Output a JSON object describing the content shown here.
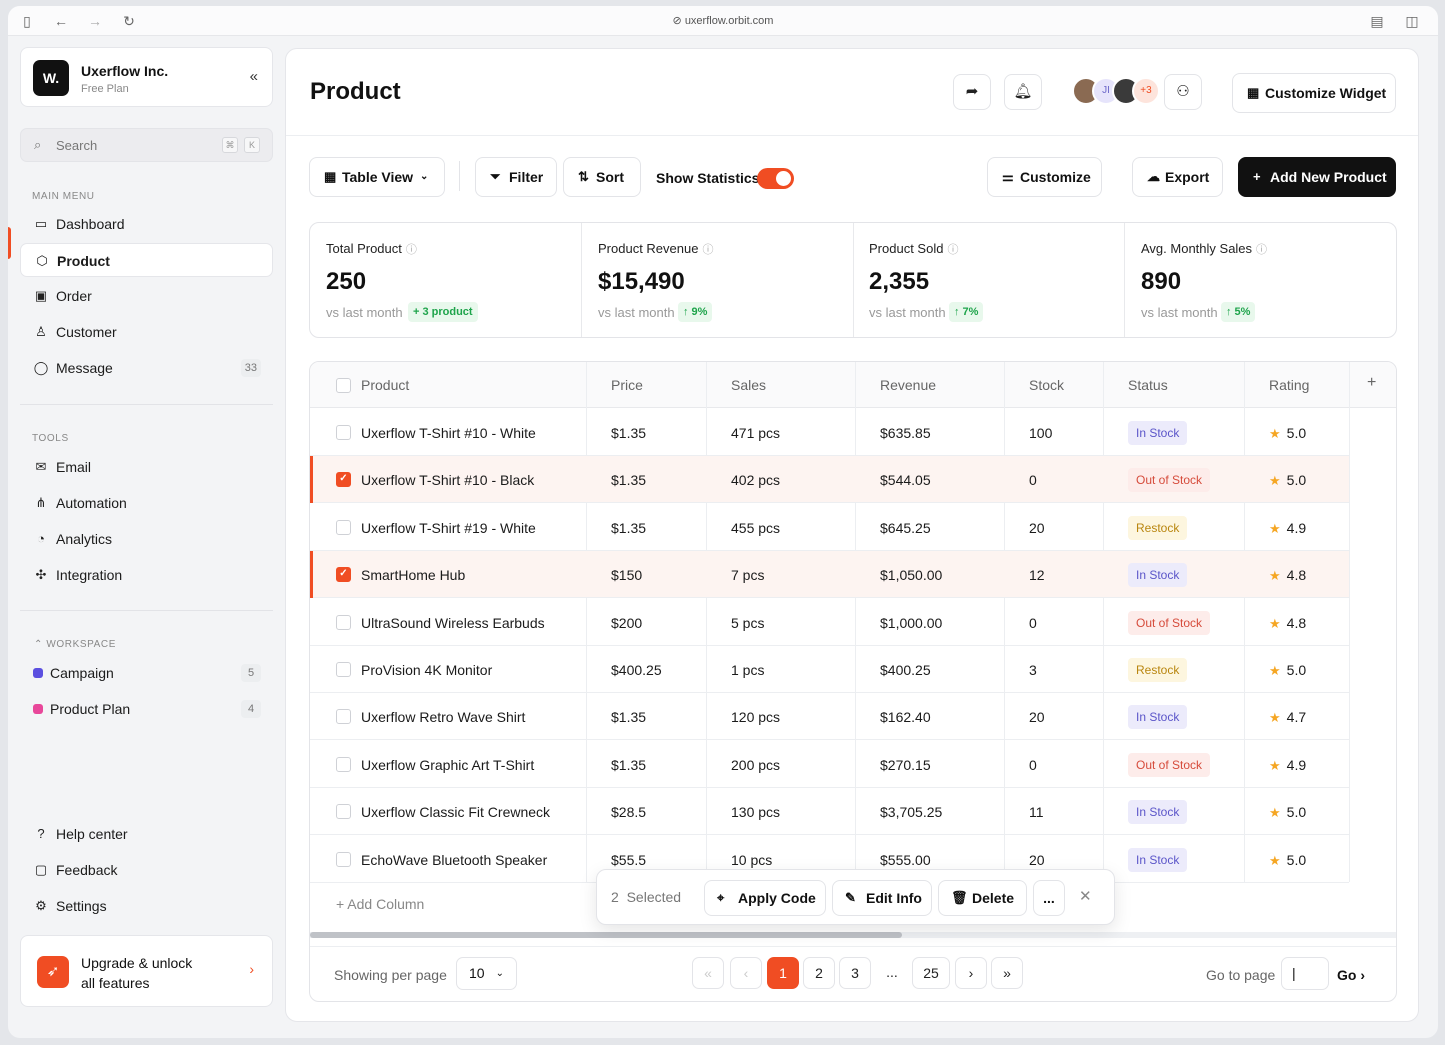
{
  "browser": {
    "url": "uxerflow.orbit.com"
  },
  "brand": {
    "name": "Uxerflow Inc.",
    "plan": "Free Plan",
    "logo": "W."
  },
  "search": {
    "placeholder": "Search",
    "key1": "⌘",
    "key2": "K"
  },
  "sidebar": {
    "main_menu_label": "MAIN MENU",
    "main_menu": [
      {
        "label": "Dashboard",
        "icon": "dashboard-icon"
      },
      {
        "label": "Product",
        "icon": "box-icon"
      },
      {
        "label": "Order",
        "icon": "order-icon"
      },
      {
        "label": "Customer",
        "icon": "users-icon"
      },
      {
        "label": "Message",
        "icon": "message-icon",
        "count": "33"
      }
    ],
    "tools_label": "TOOLS",
    "tools": [
      {
        "label": "Email",
        "icon": "mail-icon"
      },
      {
        "label": "Automation",
        "icon": "automation-icon"
      },
      {
        "label": "Analytics",
        "icon": "analytics-icon"
      },
      {
        "label": "Integration",
        "icon": "integration-icon"
      }
    ],
    "workspace_label": "WORKSPACE",
    "workspace": [
      {
        "label": "Campaign",
        "count": "5",
        "color": "#5b4fe0"
      },
      {
        "label": "Product Plan",
        "count": "4",
        "color": "#e8479a"
      }
    ],
    "bottom": [
      {
        "label": "Help center",
        "icon": "help-icon"
      },
      {
        "label": "Feedback",
        "icon": "feedback-icon"
      },
      {
        "label": "Settings",
        "icon": "gear-icon"
      }
    ],
    "upgrade": {
      "line1": "Upgrade & unlock",
      "line2": "all features"
    }
  },
  "header": {
    "title": "Product",
    "avatar_initials": "JI",
    "avatar_more": "+3",
    "customize_widget": "Customize Widget"
  },
  "toolbar": {
    "view": "Table View",
    "filter": "Filter",
    "sort": "Sort",
    "show_statistics": "Show Statistics",
    "customize": "Customize",
    "export": "Export",
    "add_new": "Add New Product"
  },
  "stats": [
    {
      "label": "Total Product",
      "value": "250",
      "compare": "vs last month",
      "delta": "+ 3 product"
    },
    {
      "label": "Product Revenue",
      "value": "$15,490",
      "compare": "vs last month",
      "delta": "↑ 9%"
    },
    {
      "label": "Product Sold",
      "value": "2,355",
      "compare": "vs last month",
      "delta": "↑ 7%"
    },
    {
      "label": "Avg. Monthly Sales",
      "value": "890",
      "compare": "vs last month",
      "delta": "↑ 5%"
    }
  ],
  "table": {
    "columns": [
      "Product",
      "Price",
      "Sales",
      "Revenue",
      "Stock",
      "Status",
      "Rating"
    ],
    "rows": [
      {
        "product": "Uxerflow T-Shirt #10 - White",
        "price": "$1.35",
        "sales": "471 pcs",
        "revenue": "$635.85",
        "stock": "100",
        "status": "In Stock",
        "rating": "5.0",
        "selected": false
      },
      {
        "product": "Uxerflow T-Shirt #10 - Black",
        "price": "$1.35",
        "sales": "402 pcs",
        "revenue": "$544.05",
        "stock": "0",
        "status": "Out of Stock",
        "rating": "5.0",
        "selected": true
      },
      {
        "product": "Uxerflow T-Shirt #19 - White",
        "price": "$1.35",
        "sales": "455 pcs",
        "revenue": "$645.25",
        "stock": "20",
        "status": "Restock",
        "rating": "4.9",
        "selected": false
      },
      {
        "product": "SmartHome Hub",
        "price": "$150",
        "sales": "7 pcs",
        "revenue": "$1,050.00",
        "stock": "12",
        "status": "In Stock",
        "rating": "4.8",
        "selected": true
      },
      {
        "product": "UltraSound Wireless Earbuds",
        "price": "$200",
        "sales": "5 pcs",
        "revenue": "$1,000.00",
        "stock": "0",
        "status": "Out of Stock",
        "rating": "4.8",
        "selected": false
      },
      {
        "product": "ProVision 4K Monitor",
        "price": "$400.25",
        "sales": "1 pcs",
        "revenue": "$400.25",
        "stock": "3",
        "status": "Restock",
        "rating": "5.0",
        "selected": false
      },
      {
        "product": "Uxerflow Retro Wave Shirt",
        "price": "$1.35",
        "sales": "120 pcs",
        "revenue": "$162.40",
        "stock": "20",
        "status": "In Stock",
        "rating": "4.7",
        "selected": false
      },
      {
        "product": "Uxerflow Graphic Art T-Shirt",
        "price": "$1.35",
        "sales": "200 pcs",
        "revenue": "$270.15",
        "stock": "0",
        "status": "Out of Stock",
        "rating": "4.9",
        "selected": false
      },
      {
        "product": "Uxerflow Classic Fit Crewneck",
        "price": "$28.5",
        "sales": "130 pcs",
        "revenue": "$3,705.25",
        "stock": "11",
        "status": "In Stock",
        "rating": "5.0",
        "selected": false
      },
      {
        "product": "EchoWave Bluetooth Speaker",
        "price": "$55.5",
        "sales": "10 pcs",
        "revenue": "$555.00",
        "stock": "20",
        "status": "In Stock",
        "rating": "5.0",
        "selected": false
      }
    ],
    "add_column": "Add Column",
    "scroll_fraction": 0.545
  },
  "pagination": {
    "per_page_label": "Showing per page",
    "per_page": "10",
    "pages": [
      "1",
      "2",
      "3",
      "...",
      "25"
    ],
    "current": "1",
    "goto_label": "Go to page",
    "goto_value": "|",
    "go": "Go"
  },
  "selection_bar": {
    "selected": "2",
    "selected_label": "Selected",
    "apply_code": "Apply Code",
    "edit_info": "Edit Info",
    "delete": "Delete",
    "more": "..."
  },
  "colors": {
    "accent": "#f04d23"
  }
}
